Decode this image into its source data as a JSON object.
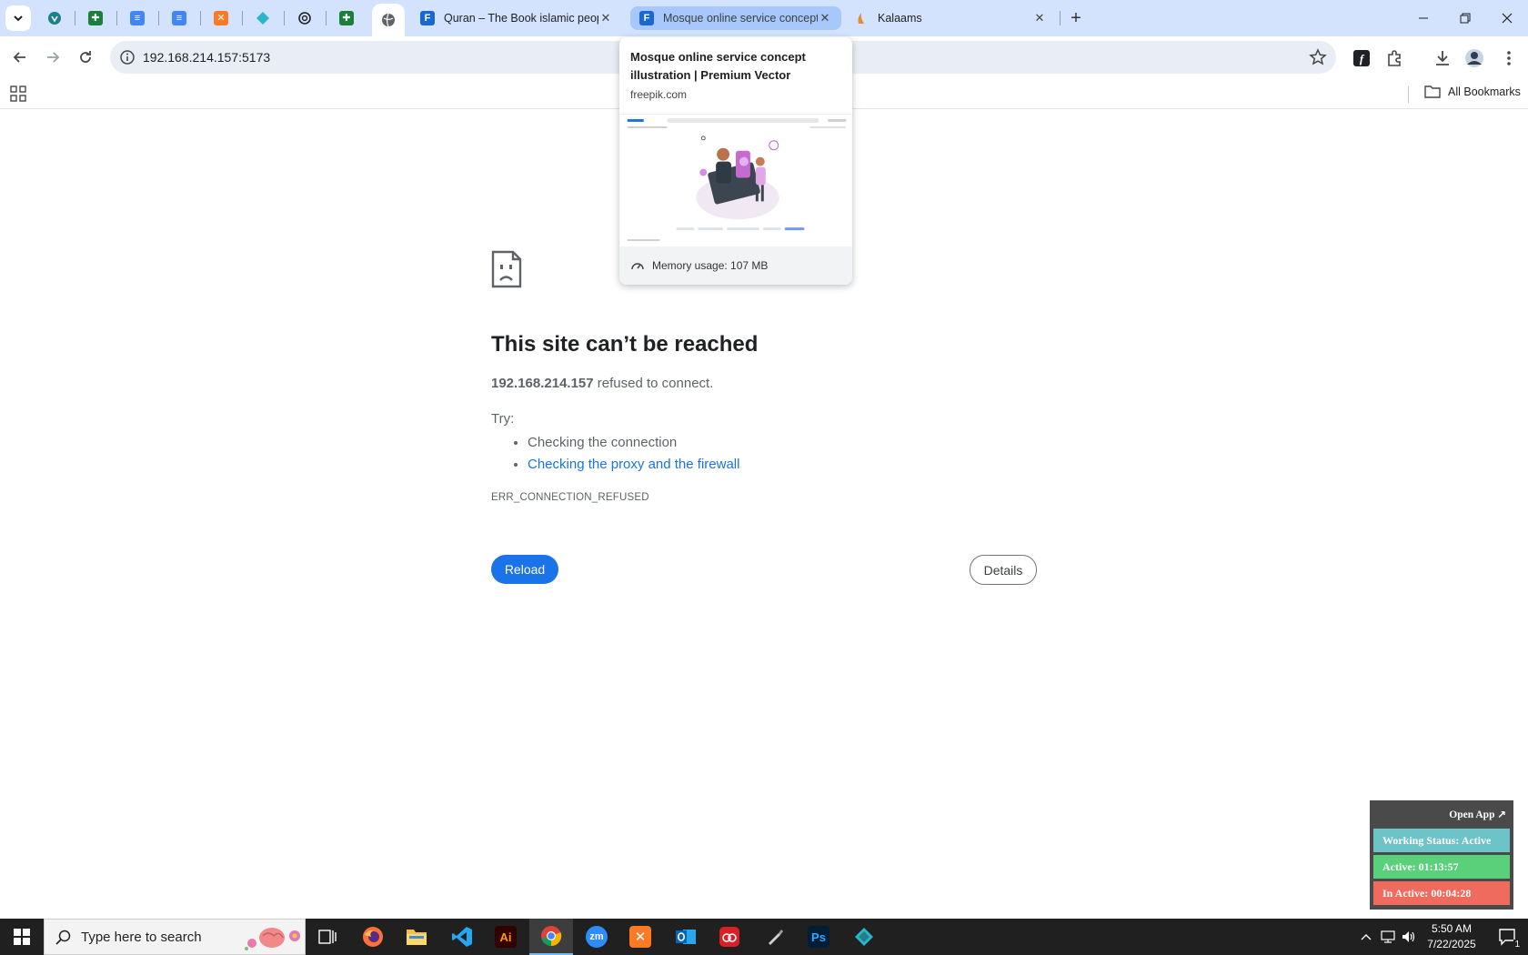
{
  "browser": {
    "pinned_tabs": [
      {
        "icon": "vpn-shield-icon",
        "color": "#1a7f8e"
      },
      {
        "icon": "google-sheets-icon",
        "color": "#188038"
      },
      {
        "icon": "google-docs-icon",
        "color": "#4285f4"
      },
      {
        "icon": "google-docs-icon",
        "color": "#4285f4"
      },
      {
        "icon": "xampp-icon",
        "color": "#fb7a24"
      },
      {
        "icon": "diamond-app-icon",
        "color": "#2bb5c8"
      },
      {
        "icon": "openai-icon",
        "color": "#202124"
      },
      {
        "icon": "google-sheets-icon",
        "color": "#188038"
      },
      {
        "icon": "globe-icon",
        "color": "#5f6368"
      }
    ],
    "tabs": [
      {
        "title": "Quran – The Book islamic peop",
        "favicon": "freepik-icon"
      },
      {
        "title": "Mosque online service concept",
        "favicon": "freepik-icon"
      },
      {
        "title": "Kalaams",
        "favicon": "kalaams-icon"
      }
    ],
    "url": "192.168.214.157:5173",
    "bookmarks": {
      "all_bookmarks_label": "All Bookmarks"
    }
  },
  "hovercard": {
    "title": "Mosque online service concept illustration | Premium Vector",
    "domain": "freepik.com",
    "memory": "Memory usage: 107 MB"
  },
  "error_page": {
    "title": "This site can’t be reached",
    "host": "192.168.214.157",
    "message_suffix": " refused to connect.",
    "try_label": "Try:",
    "suggestions": [
      {
        "text": "Checking the connection",
        "link": false
      },
      {
        "text": "Checking the proxy and the firewall",
        "link": true
      }
    ],
    "error_code": "ERR_CONNECTION_REFUSED",
    "reload_label": "Reload",
    "details_label": "Details"
  },
  "widget": {
    "open_app": "Open App ↗",
    "working_status": "Working Status: Active",
    "active": "Active: 01:13:57",
    "inactive": "In Active: 00:04:28",
    "colors": {
      "status": "#6cc3c8",
      "active": "#5bd07a",
      "inactive": "#ee6b5e"
    }
  },
  "taskbar": {
    "search_placeholder": "Type here to search",
    "apps": [
      "task-view-icon",
      "firefox-icon",
      "file-explorer-icon",
      "vscode-icon",
      "illustrator-icon",
      "chrome-icon",
      "zoom-icon",
      "xampp-icon",
      "outlook-icon",
      "creative-cloud-icon",
      "pen-tool-icon",
      "photoshop-icon",
      "diamond-app-icon"
    ],
    "illustrator_label": "Ai",
    "zoom_label": "zm",
    "photoshop_label": "Ps",
    "time": "5:50 AM",
    "date": "7/22/2025",
    "notification_count": "1"
  }
}
